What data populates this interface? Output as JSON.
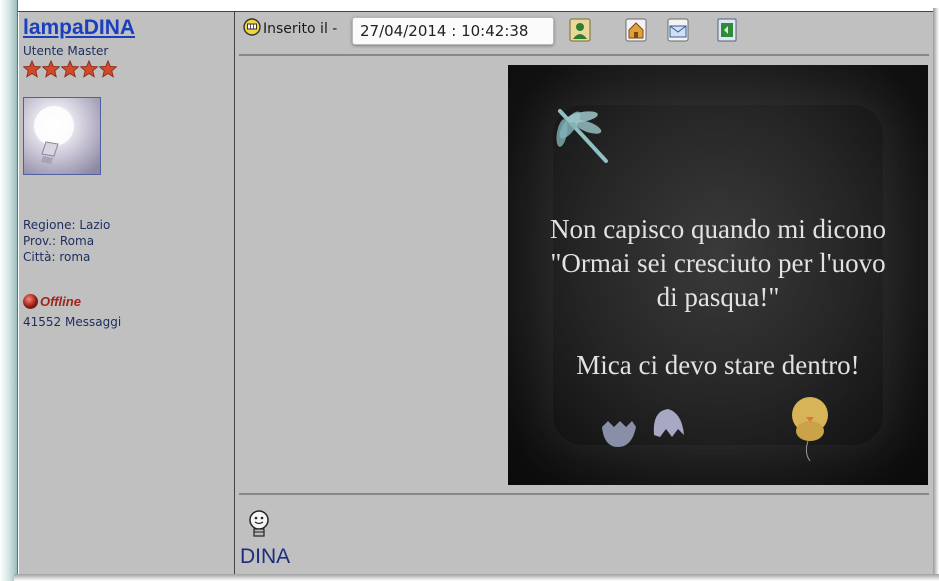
{
  "user": {
    "username": "lampaDINA",
    "rank": "Utente Master",
    "star_count": 5,
    "region": "Regione: Lazio",
    "province": "Prov.: Roma",
    "city": "Città: roma",
    "status": "Offline",
    "messages": "41552 Messaggi"
  },
  "post": {
    "inserted_label": "Inserito il -",
    "date": "27/04/2014",
    "separator": ":",
    "time": "10:42:38",
    "toolbar_icons": [
      "profile-icon",
      "homepage-icon",
      "email-icon",
      "reply-quote-icon"
    ],
    "image_lines": [
      "Non capisco quando mi dicono",
      "\"Ormai sei cresciuto per l'uovo",
      "di pasqua!\"",
      "Mica ci devo stare dentro!"
    ],
    "signature": "DINA"
  },
  "colors": {
    "panel_bg": "#c0c0c0",
    "username": "#1a3fbf",
    "offline": "#a0241a"
  }
}
